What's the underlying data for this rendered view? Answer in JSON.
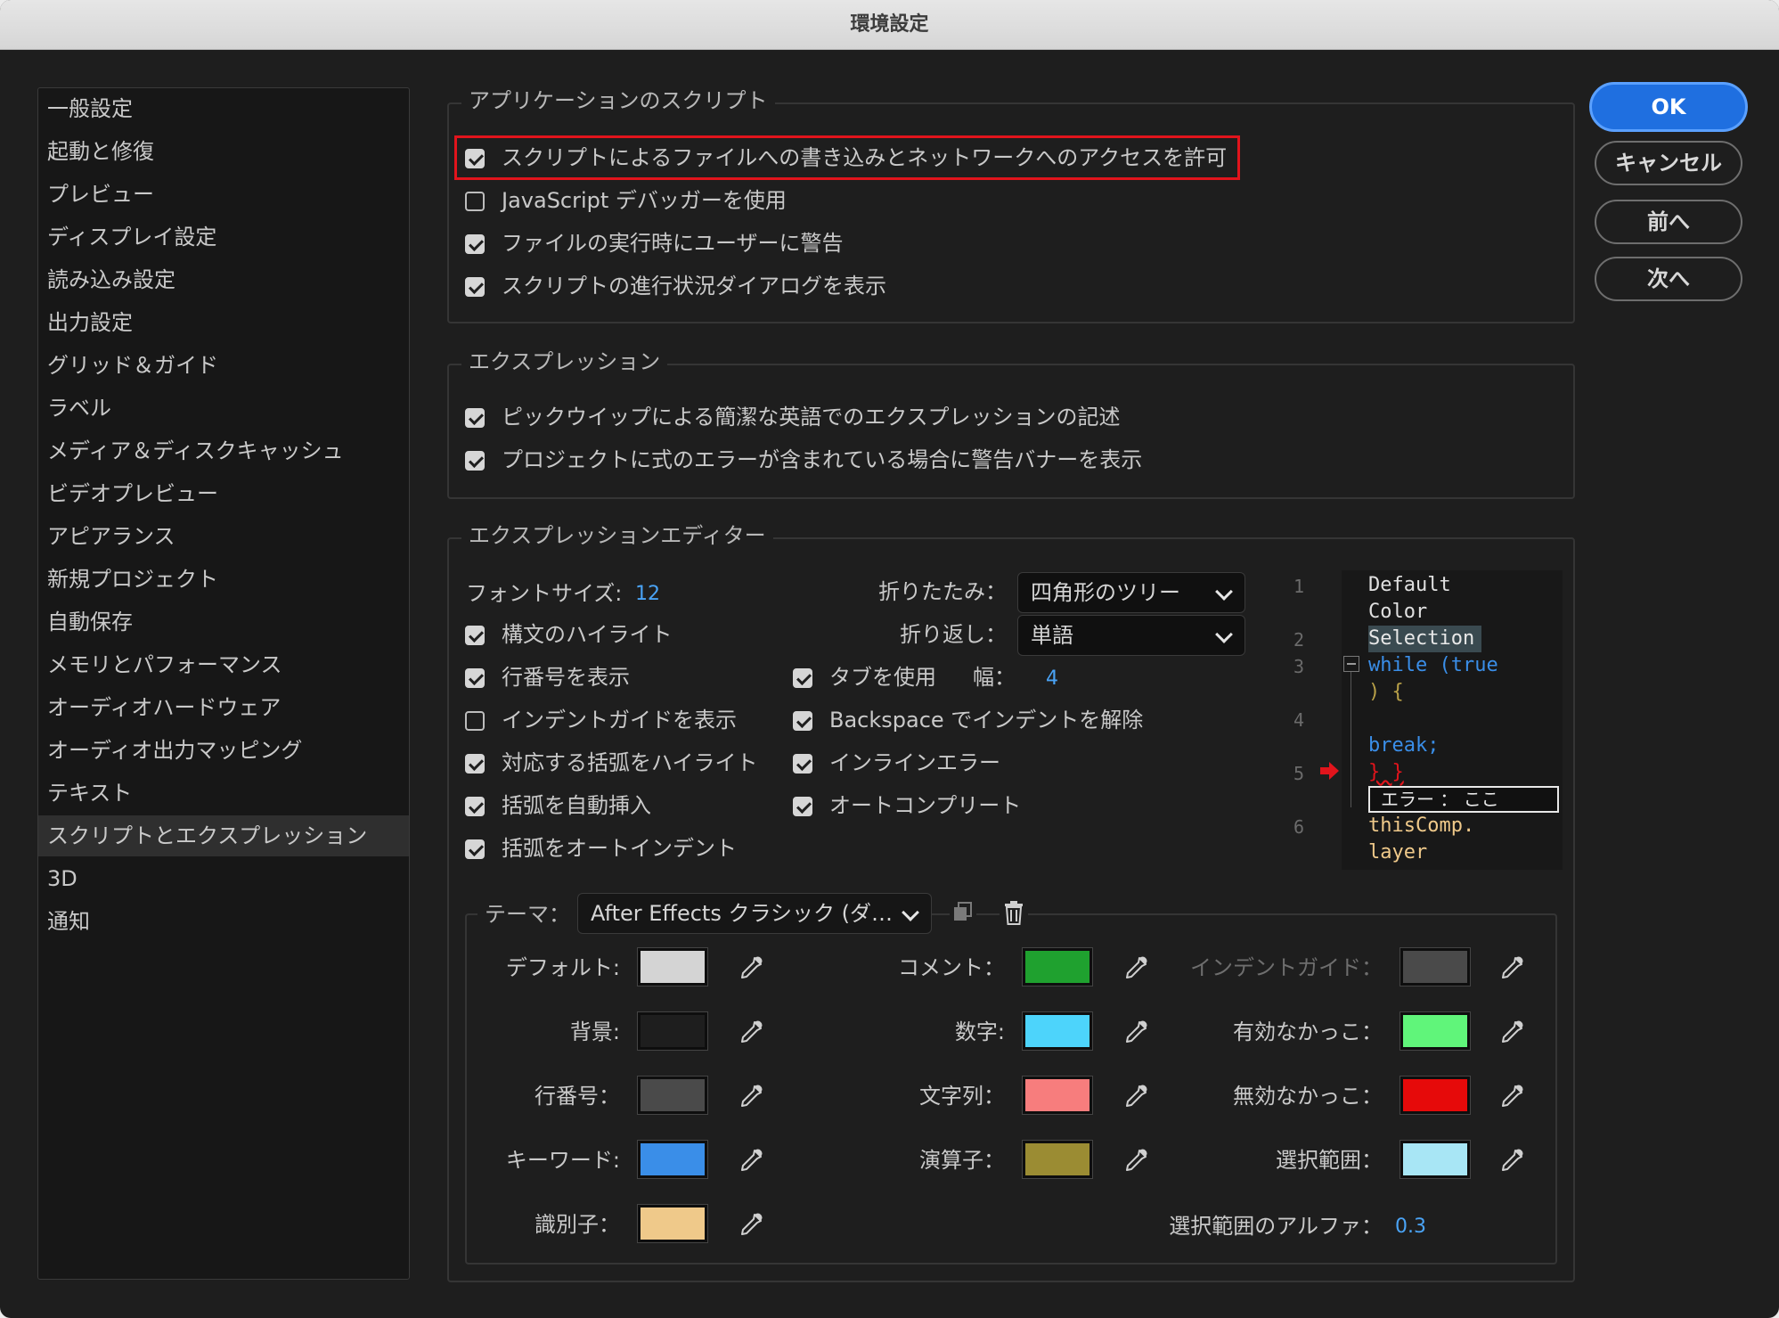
{
  "window": {
    "title": "環境設定"
  },
  "sidebar": {
    "items": [
      {
        "label": "一般設定"
      },
      {
        "label": "起動と修復"
      },
      {
        "label": "プレビュー"
      },
      {
        "label": "ディスプレイ設定"
      },
      {
        "label": "読み込み設定"
      },
      {
        "label": "出力設定"
      },
      {
        "label": "グリッド＆ガイド"
      },
      {
        "label": "ラベル"
      },
      {
        "label": "メディア＆ディスクキャッシュ"
      },
      {
        "label": "ビデオプレビュー"
      },
      {
        "label": "アピアランス"
      },
      {
        "label": "新規プロジェクト"
      },
      {
        "label": "自動保存"
      },
      {
        "label": "メモリとパフォーマンス"
      },
      {
        "label": "オーディオハードウェア"
      },
      {
        "label": "オーディオ出力マッピング"
      },
      {
        "label": "テキスト"
      },
      {
        "label": "スクリプトとエクスプレッション"
      },
      {
        "label": "3D"
      },
      {
        "label": "通知"
      }
    ],
    "selected_index": 17
  },
  "buttons": {
    "ok": "OK",
    "cancel": "キャンセル",
    "prev": "前へ",
    "next": "次へ"
  },
  "app_scripts": {
    "legend": "アプリケーションのスクリプト",
    "options": [
      {
        "label": "スクリプトによるファイルへの書き込みとネットワークへのアクセスを許可",
        "checked": true
      },
      {
        "label": "JavaScript デバッガーを使用",
        "checked": false
      },
      {
        "label": "ファイルの実行時にユーザーに警告",
        "checked": true
      },
      {
        "label": "スクリプトの進行状況ダイアログを表示",
        "checked": true
      }
    ]
  },
  "expressions": {
    "legend": "エクスプレッション",
    "options": [
      {
        "label": "ピックウイップによる簡潔な英語でのエクスプレッションの記述",
        "checked": true
      },
      {
        "label": "プロジェクトに式のエラーが含まれている場合に警告バナーを表示",
        "checked": true
      }
    ]
  },
  "editor": {
    "legend": "エクスプレッションエディター",
    "font_size_label": "フォントサイズ:",
    "font_size_value": "12",
    "fold_label": "折りたたみ：",
    "fold_value": "四角形のツリー",
    "wrap_label": "折り返し：",
    "wrap_value": "単語",
    "tab_width_label": "幅：",
    "tab_width_value": "4",
    "left_options": [
      {
        "label": "構文のハイライト",
        "checked": true
      },
      {
        "label": "行番号を表示",
        "checked": true
      },
      {
        "label": "インデントガイドを表示",
        "checked": false
      },
      {
        "label": "対応する括弧をハイライト",
        "checked": true
      },
      {
        "label": "括弧を自動挿入",
        "checked": true
      },
      {
        "label": "括弧をオートインデント",
        "checked": true
      }
    ],
    "right_options": [
      {
        "label": "タブを使用",
        "checked": true
      },
      {
        "label": "Backspace でインデントを解除",
        "checked": true
      },
      {
        "label": "インラインエラー",
        "checked": true
      },
      {
        "label": "オートコンプリート",
        "checked": true
      }
    ],
    "preview": {
      "line_numbers": [
        "1",
        "2",
        "3",
        "4",
        "5",
        "6"
      ],
      "lines": [
        "Default",
        "Color",
        "Selection",
        "while (true",
        ") {",
        "break;",
        "} }",
        "thisComp.",
        "layer"
      ],
      "error_text": "エラー ： ここ"
    }
  },
  "theme": {
    "label": "テーマ：",
    "value": "After Effects クラシック (ダ…",
    "colors": [
      {
        "label": "デフォルト:",
        "hex": "#d4d4d4"
      },
      {
        "label": "背景:",
        "hex": "#1e1e1e"
      },
      {
        "label": "行番号：",
        "hex": "#4a4a4a"
      },
      {
        "label": "キーワード:",
        "hex": "#3a8ee8"
      },
      {
        "label": "識別子：",
        "hex": "#efc98a"
      },
      {
        "label": "コメント：",
        "hex": "#1fa12f"
      },
      {
        "label": "数字:",
        "hex": "#4dd4fb"
      },
      {
        "label": "文字列：",
        "hex": "#f77d7d"
      },
      {
        "label": "演算子：",
        "hex": "#9b8c33"
      },
      {
        "label": "インデントガイド：",
        "hex": "#4a4a4a"
      },
      {
        "label": "有効なかっこ：",
        "hex": "#60f57a"
      },
      {
        "label": "無効なかっこ：",
        "hex": "#e60a0a"
      },
      {
        "label": "選択範囲：",
        "hex": "#a8e6f5"
      }
    ],
    "alpha_label": "選択範囲のアルファ：",
    "alpha_value": "0.3"
  },
  "accent": {
    "red_outline": "#e1141c",
    "blue": "#4aa3f5",
    "ok_button": "#1f6fe0"
  }
}
